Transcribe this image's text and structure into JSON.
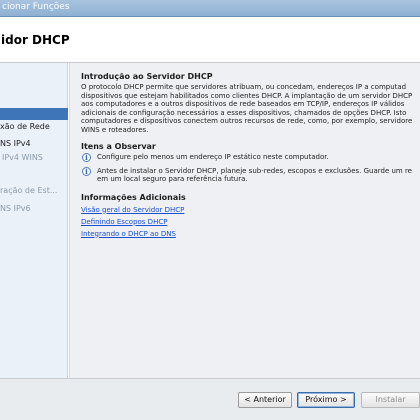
{
  "window": {
    "title": "cionar Funções"
  },
  "header": {
    "title": "idor DHCP"
  },
  "sidebar": {
    "items": [
      {
        "label": "xão de Rede",
        "state": "normal"
      },
      {
        "label": "NS IPv4",
        "state": "normal"
      },
      {
        "label": "IPv4 WINS",
        "state": "muted"
      },
      {
        "label": "ração de Est...",
        "state": "muted"
      },
      {
        "label": "NS IPv6",
        "state": "muted"
      }
    ]
  },
  "main": {
    "intro": {
      "title": "Introdução ao Servidor DHCP",
      "lines": [
        "O protocolo DHCP permite que servidores atribuam, ou concedam, endereços IP a computad",
        "dispositivos que estejam habilitados como clientes DHCP. A implantação de um servidor DHCP",
        "aos computadores e a outros dispositivos de rede baseados em TCP/IP, endereços IP válidos",
        "adicionais de configuração necessários a esses dispositivos, chamados de opções DHCP. Isto",
        "computadores e dispositivos conectem outros recursos de rede, como, por exemplo, servidore",
        "WINS e roteadores."
      ]
    },
    "notes": {
      "title": "Itens a Observar",
      "items": [
        {
          "icon": "info-icon",
          "lines": [
            "Configure pelo menos um endereço IP estático neste computador."
          ]
        },
        {
          "icon": "info-icon",
          "lines": [
            "Antes de instalar o Servidor DHCP, planeje sub-redes, escopos e exclusões. Guarde um re",
            "em um local seguro para referência futura."
          ]
        }
      ]
    },
    "more_info": {
      "title": "Informações Adicionais",
      "links": [
        "Visão geral do Servidor DHCP",
        "Definindo Escopos DHCP",
        "Integrando o DHCP ao DNS"
      ]
    }
  },
  "footer": {
    "back": "< Anterior",
    "next": "Próximo >",
    "install": "Instalar"
  },
  "colors": {
    "selected": "#3d75b8",
    "link": "#1a4fd0",
    "sidebar_bg": "#eaf1f9",
    "content_bg": "#eef0f3"
  }
}
